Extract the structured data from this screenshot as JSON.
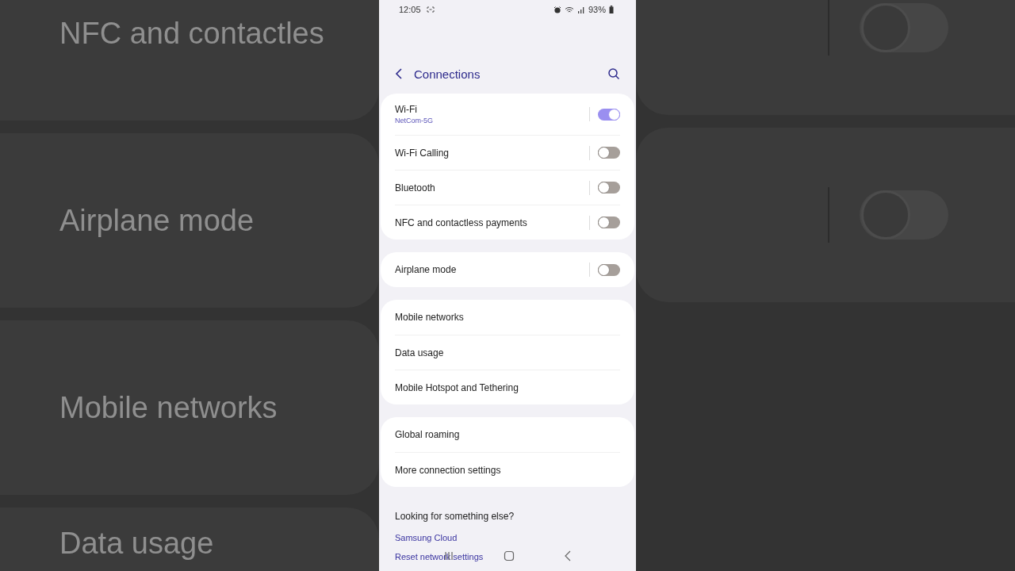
{
  "backdrop": {
    "labels": [
      "NFC and contactles",
      "Airplane mode",
      "Mobile networks",
      "Data usage"
    ],
    "toggles": [
      {
        "on": false
      },
      {
        "on": false
      }
    ]
  },
  "status_bar": {
    "time": "12:05",
    "battery": "93%"
  },
  "header": {
    "title": "Connections"
  },
  "groups": [
    {
      "items": [
        {
          "kind": "toggle",
          "label": "Wi-Fi",
          "sub": "NetCom-5G",
          "on": true
        },
        {
          "kind": "toggle",
          "label": "Wi-Fi Calling",
          "on": false
        },
        {
          "kind": "toggle",
          "label": "Bluetooth",
          "on": false
        },
        {
          "kind": "toggle",
          "label": "NFC and contactless payments",
          "on": false
        }
      ]
    },
    {
      "items": [
        {
          "kind": "toggle",
          "label": "Airplane mode",
          "on": false
        }
      ]
    },
    {
      "items": [
        {
          "kind": "link",
          "label": "Mobile networks"
        },
        {
          "kind": "link",
          "label": "Data usage"
        },
        {
          "kind": "link",
          "label": "Mobile Hotspot and Tethering"
        }
      ]
    },
    {
      "items": [
        {
          "kind": "link",
          "label": "Global roaming"
        },
        {
          "kind": "link",
          "label": "More connection settings"
        }
      ]
    }
  ],
  "footer": {
    "heading": "Looking for something else?",
    "links": [
      "Samsung Cloud",
      "Reset network settings"
    ]
  }
}
